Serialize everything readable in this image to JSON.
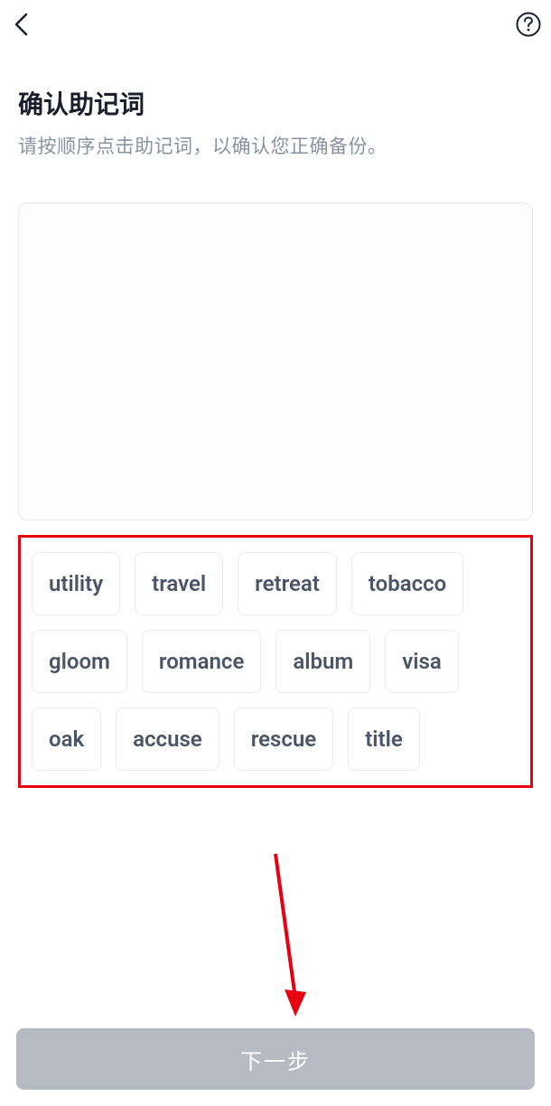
{
  "header": {
    "back_icon": "back",
    "help_icon": "help"
  },
  "page": {
    "title": "确认助记词",
    "subtitle": "请按顺序点击助记词，以确认您正确备份。"
  },
  "words": {
    "row1": [
      "utility",
      "travel",
      "retreat",
      "tobacco"
    ],
    "row2": [
      "gloom",
      "romance",
      "album",
      "visa"
    ],
    "row3": [
      "oak",
      "accuse",
      "rescue",
      "title"
    ]
  },
  "footer": {
    "next_label": "下一步"
  },
  "annotation": {
    "highlight_color": "#e60012"
  }
}
